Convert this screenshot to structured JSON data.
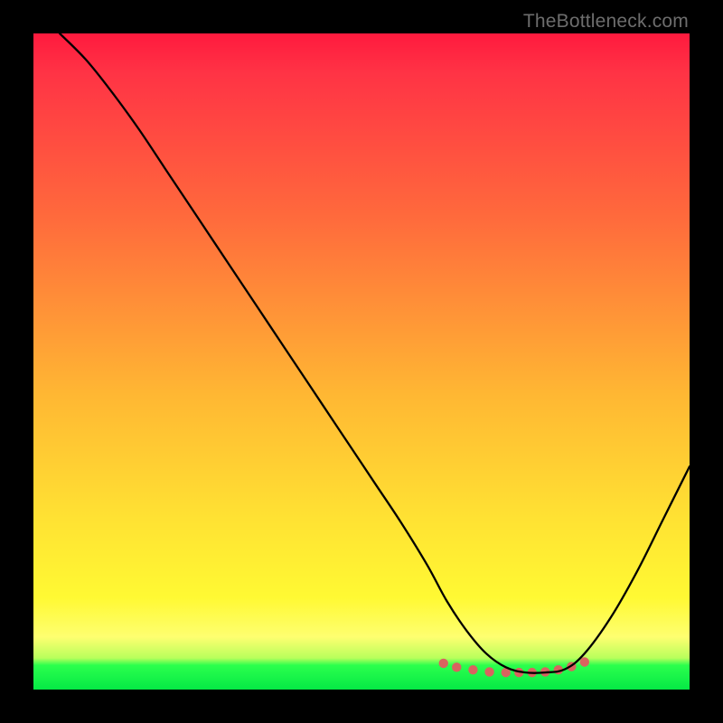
{
  "watermark": "TheBottleneck.com",
  "chart_data": {
    "type": "line",
    "title": "",
    "xlabel": "",
    "ylabel": "",
    "xlim": [
      0,
      100
    ],
    "ylim": [
      0,
      100
    ],
    "grid": false,
    "legend": false,
    "series": [
      {
        "name": "bottleneck-curve",
        "color": "#000000",
        "x": [
          4,
          8,
          12,
          16,
          20,
          24,
          28,
          32,
          36,
          40,
          44,
          48,
          52,
          56,
          60,
          63,
          66,
          69,
          72,
          75,
          78,
          81,
          84,
          88,
          92,
          96,
          100
        ],
        "y": [
          100,
          96,
          91,
          85.5,
          79.5,
          73.5,
          67.5,
          61.5,
          55.5,
          49.5,
          43.5,
          37.5,
          31.5,
          25.5,
          19,
          13.5,
          9,
          5.5,
          3.4,
          2.6,
          2.6,
          3.1,
          5.5,
          11,
          18,
          26,
          34
        ]
      },
      {
        "name": "optimal-zone-markers",
        "color": "#d9635f",
        "marker": "circle",
        "x": [
          62.5,
          64.5,
          67,
          69.5,
          72,
          74,
          76,
          78,
          80,
          82,
          84
        ],
        "y": [
          4.0,
          3.4,
          3.0,
          2.7,
          2.6,
          2.6,
          2.6,
          2.7,
          3.0,
          3.5,
          4.2
        ]
      }
    ],
    "annotations": []
  }
}
